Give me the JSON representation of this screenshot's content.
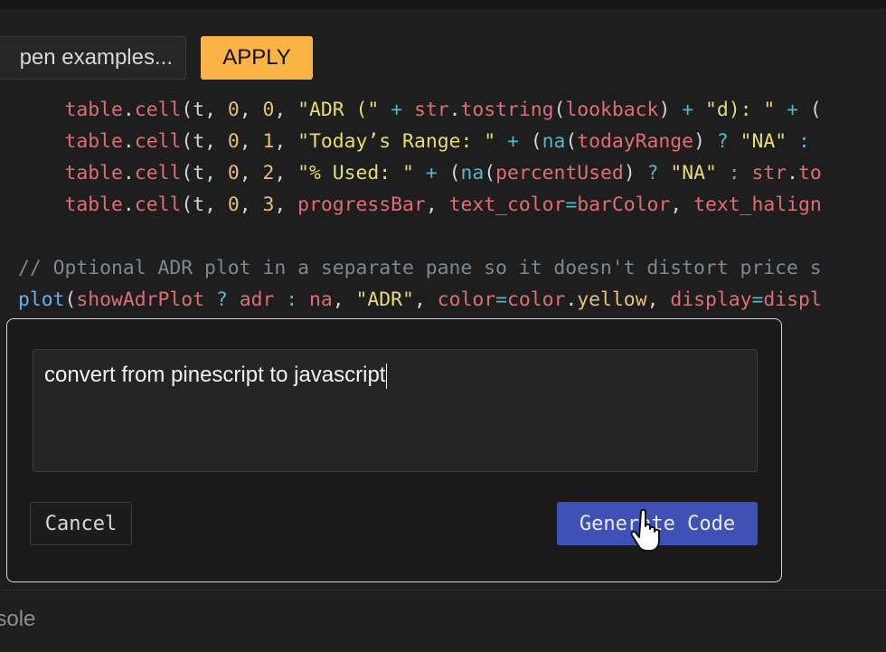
{
  "toolbar": {
    "open_examples_label": "pen examples...",
    "apply_label": "APPLY",
    "apply_color": "#f9b443"
  },
  "editor": {
    "lines": [
      {
        "parts": [
          [
            "kw",
            "table"
          ],
          [
            "fn",
            "."
          ],
          [
            "kw",
            "cell"
          ],
          [
            "fn",
            "(t, "
          ],
          [
            "num",
            "0"
          ],
          [
            "fn",
            ", "
          ],
          [
            "num",
            "0"
          ],
          [
            "fn",
            ", "
          ],
          [
            "str",
            "\"ADR (\""
          ],
          [
            "op",
            " + "
          ],
          [
            "kw",
            "str"
          ],
          [
            "fn",
            "."
          ],
          [
            "kw",
            "tostring"
          ],
          [
            "fn",
            "("
          ],
          [
            "kw",
            "lookback"
          ],
          [
            "fn",
            ")"
          ],
          [
            "op",
            " + "
          ],
          [
            "str",
            "\"d): \""
          ],
          [
            "op",
            " + "
          ],
          [
            "fn",
            "("
          ]
        ]
      },
      {
        "parts": [
          [
            "kw",
            "table"
          ],
          [
            "fn",
            "."
          ],
          [
            "kw",
            "cell"
          ],
          [
            "fn",
            "(t, "
          ],
          [
            "num",
            "0"
          ],
          [
            "fn",
            ", "
          ],
          [
            "num",
            "1"
          ],
          [
            "fn",
            ", "
          ],
          [
            "str",
            "\"Today’s Range: \""
          ],
          [
            "op",
            " + "
          ],
          [
            "fn",
            "("
          ],
          [
            "op",
            "na"
          ],
          [
            "fn",
            "("
          ],
          [
            "kw",
            "todayRange"
          ],
          [
            "fn",
            ")"
          ],
          [
            "op",
            " ? "
          ],
          [
            "str",
            "\"NA\""
          ],
          [
            "op",
            " :"
          ]
        ]
      },
      {
        "parts": [
          [
            "kw",
            "table"
          ],
          [
            "fn",
            "."
          ],
          [
            "kw",
            "cell"
          ],
          [
            "fn",
            "(t, "
          ],
          [
            "num",
            "0"
          ],
          [
            "fn",
            ", "
          ],
          [
            "num",
            "2"
          ],
          [
            "fn",
            ", "
          ],
          [
            "str",
            "\"% Used: \""
          ],
          [
            "op",
            " + "
          ],
          [
            "fn",
            "("
          ],
          [
            "op",
            "na"
          ],
          [
            "fn",
            "("
          ],
          [
            "kw",
            "percentUsed"
          ],
          [
            "fn",
            ")"
          ],
          [
            "op",
            " ? "
          ],
          [
            "str",
            "\"NA\""
          ],
          [
            "op",
            " : "
          ],
          [
            "kw",
            "str"
          ],
          [
            "fn",
            "."
          ],
          [
            "kw",
            "to"
          ]
        ]
      },
      {
        "parts": [
          [
            "kw",
            "table"
          ],
          [
            "fn",
            "."
          ],
          [
            "kw",
            "cell"
          ],
          [
            "fn",
            "(t, "
          ],
          [
            "num",
            "0"
          ],
          [
            "fn",
            ", "
          ],
          [
            "num",
            "3"
          ],
          [
            "fn",
            ", "
          ],
          [
            "kw",
            "progressBar"
          ],
          [
            "fn",
            ", "
          ],
          [
            "kw",
            "text_color"
          ],
          [
            "op",
            "="
          ],
          [
            "kw",
            "barColor"
          ],
          [
            "fn",
            ", "
          ],
          [
            "kw",
            "text_halign"
          ]
        ]
      },
      {
        "parts": []
      },
      {
        "parts": [
          [
            "cmt",
            "// Optional ADR plot in a separate pane so it doesn't distort price s"
          ]
        ]
      },
      {
        "parts": [
          [
            "plot",
            "plot"
          ],
          [
            "fn",
            "("
          ],
          [
            "kw",
            "showAdrPlot"
          ],
          [
            "op",
            " ? "
          ],
          [
            "kw",
            "adr"
          ],
          [
            "op",
            " : "
          ],
          [
            "kw",
            "na"
          ],
          [
            "fn",
            ", "
          ],
          [
            "str",
            "\"ADR\""
          ],
          [
            "fn",
            ", "
          ],
          [
            "kw",
            "color"
          ],
          [
            "op",
            "="
          ],
          [
            "kw",
            "color"
          ],
          [
            "fn",
            "."
          ],
          [
            "num",
            "yellow"
          ],
          [
            "fn",
            ", "
          ],
          [
            "kw",
            "display"
          ],
          [
            "op",
            "="
          ],
          [
            "kw",
            "displ"
          ]
        ]
      }
    ],
    "indent": [
      "    ",
      "    ",
      "    ",
      "    ",
      "",
      "",
      ""
    ]
  },
  "dialog": {
    "prompt_value": "convert from pinescript to javascript",
    "cancel_label": "Cancel",
    "generate_label": "Generate Code",
    "generate_color": "#3f51b5"
  },
  "bottom": {
    "console_label": "nsole"
  }
}
